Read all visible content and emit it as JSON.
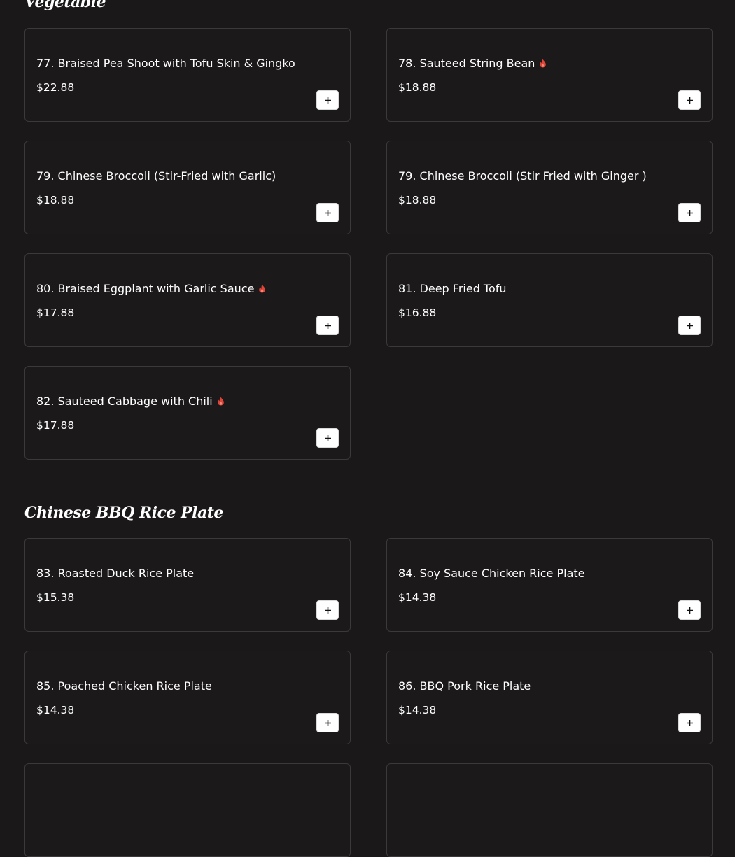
{
  "sections": [
    {
      "title": "Vegetable",
      "items": [
        {
          "name": "77. Braised Pea Shoot with Tofu Skin & Gingko",
          "price": "$22.88",
          "spicy": false
        },
        {
          "name": "78. Sauteed String Bean",
          "price": "$18.88",
          "spicy": true
        },
        {
          "name": "79. Chinese Broccoli (Stir-Fried with Garlic)",
          "price": "$18.88",
          "spicy": false
        },
        {
          "name": "79. Chinese Broccoli (Stir Fried with Ginger )",
          "price": "$18.88",
          "spicy": false
        },
        {
          "name": "80. Braised Eggplant with Garlic Sauce",
          "price": "$17.88",
          "spicy": true
        },
        {
          "name": "81. Deep Fried Tofu",
          "price": "$16.88",
          "spicy": false
        },
        {
          "name": "82. Sauteed Cabbage with Chili",
          "price": "$17.88",
          "spicy": true
        }
      ]
    },
    {
      "title": "Chinese BBQ Rice Plate",
      "items": [
        {
          "name": "83. Roasted Duck Rice Plate",
          "price": "$15.38",
          "spicy": false
        },
        {
          "name": "84. Soy Sauce Chicken Rice Plate",
          "price": "$14.38",
          "spicy": false
        },
        {
          "name": "85. Poached Chicken Rice Plate",
          "price": "$14.38",
          "spicy": false
        },
        {
          "name": "86. BBQ Pork Rice Plate",
          "price": "$14.38",
          "spicy": false
        }
      ]
    }
  ],
  "icons": {
    "spicy": "flame-icon",
    "add": "plus-icon"
  },
  "colors": {
    "background": "#1a1818",
    "card_border": "#3b3939",
    "spicy": "#e0453a",
    "button": "#ffffff"
  }
}
